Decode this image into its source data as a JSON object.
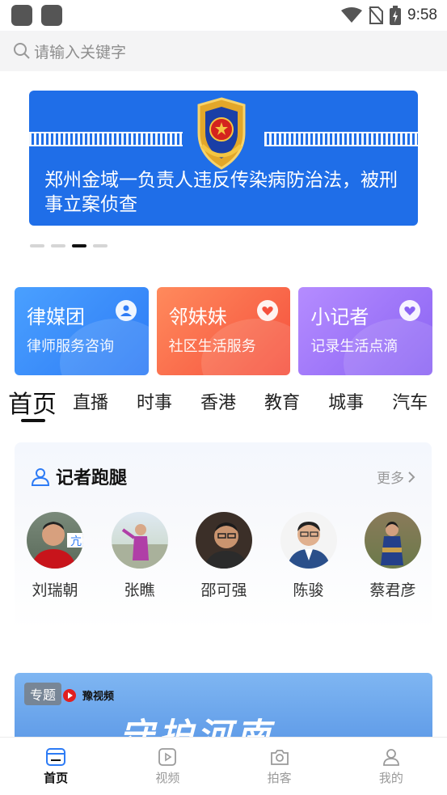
{
  "status_bar": {
    "time": "9:58"
  },
  "search": {
    "placeholder": "请输入关键字"
  },
  "banner": {
    "caption": "郑州金域一负责人违反传染病防治法，被刑事立案侦查",
    "dots": 4,
    "active_dot": 3
  },
  "service_cards": [
    {
      "title": "律媒团",
      "subtitle": "律师服务咨询",
      "icon": "person-icon",
      "color": "#2d7bf5"
    },
    {
      "title": "邻妹妹",
      "subtitle": "社区生活服务",
      "icon": "heart-bubble-icon",
      "color": "#f5503d"
    },
    {
      "title": "小记者",
      "subtitle": "记录生活点滴",
      "icon": "heart-bubble-icon",
      "color": "#8a63f3"
    }
  ],
  "channel_tabs": [
    "首页",
    "直播",
    "时事",
    "香港",
    "教育",
    "城事",
    "汽车"
  ],
  "active_tab": "首页",
  "reporters": {
    "title": "记者跑腿",
    "more_label": "更多",
    "items": [
      {
        "name": "刘瑞朝"
      },
      {
        "name": "张瞧"
      },
      {
        "name": "邵可强"
      },
      {
        "name": "陈骏"
      },
      {
        "name": "蔡君彦"
      }
    ]
  },
  "topic": {
    "tag": "专题",
    "logo_text": "豫视频",
    "headline": "守护河南"
  },
  "bottom_nav": [
    {
      "label": "首页",
      "icon": "home-icon",
      "active": true
    },
    {
      "label": "视频",
      "icon": "video-icon",
      "active": false
    },
    {
      "label": "拍客",
      "icon": "camera-icon",
      "active": false
    },
    {
      "label": "我的",
      "icon": "profile-icon",
      "active": false
    }
  ]
}
